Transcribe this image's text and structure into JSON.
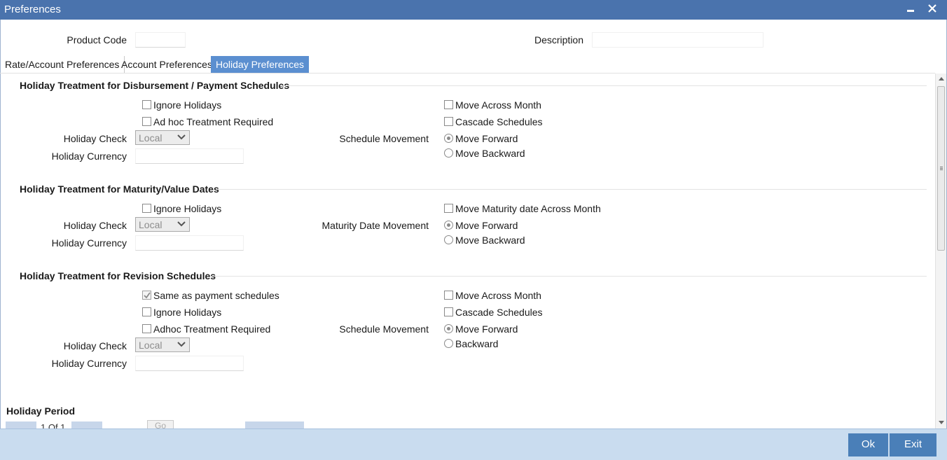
{
  "window": {
    "title": "Preferences"
  },
  "header": {
    "product_code_label": "Product Code",
    "product_code_value": "",
    "description_label": "Description",
    "description_value": ""
  },
  "tabs": [
    {
      "label": "Rate/Account Preferences",
      "active": false
    },
    {
      "label": "Account Preferences",
      "active": false
    },
    {
      "label": "Holiday Preferences",
      "active": true
    }
  ],
  "disbursement": {
    "title": "Holiday Treatment for Disbursement / Payment Schedules",
    "ignore_holidays": {
      "label": "Ignore Holidays",
      "checked": false
    },
    "adhoc_treatment": {
      "label": "Ad hoc Treatment Required",
      "checked": false
    },
    "holiday_check_label": "Holiday Check",
    "holiday_check_value": "Local",
    "holiday_currency_label": "Holiday Currency",
    "holiday_currency_value": "",
    "move_across_month": {
      "label": "Move Across Month",
      "checked": false
    },
    "cascade_schedules": {
      "label": "Cascade Schedules",
      "checked": false
    },
    "schedule_movement_label": "Schedule Movement",
    "move_forward": {
      "label": "Move Forward",
      "selected": true
    },
    "move_backward": {
      "label": "Move Backward",
      "selected": false
    }
  },
  "maturity": {
    "title": "Holiday Treatment for Maturity/Value Dates",
    "ignore_holidays": {
      "label": "Ignore Holidays",
      "checked": false
    },
    "holiday_check_label": "Holiday Check",
    "holiday_check_value": "Local",
    "holiday_currency_label": "Holiday Currency",
    "holiday_currency_value": "",
    "move_maturity_across_month": {
      "label": "Move Maturity date Across Month",
      "checked": false
    },
    "maturity_date_movement_label": "Maturity Date Movement",
    "move_forward": {
      "label": "Move Forward",
      "selected": true
    },
    "move_backward": {
      "label": "Move Backward",
      "selected": false
    }
  },
  "revision": {
    "title": "Holiday Treatment for Revision Schedules",
    "same_as_payment": {
      "label": "Same as payment schedules",
      "checked": true
    },
    "ignore_holidays": {
      "label": "Ignore Holidays",
      "checked": false
    },
    "adhoc_treatment": {
      "label": "Adhoc Treatment Required",
      "checked": false
    },
    "holiday_check_label": "Holiday Check",
    "holiday_check_value": "Local",
    "holiday_currency_label": "Holiday Currency",
    "holiday_currency_value": "",
    "move_across_month": {
      "label": "Move Across Month",
      "checked": false
    },
    "cascade_schedules": {
      "label": "Cascade Schedules",
      "checked": false
    },
    "schedule_movement_label": "Schedule Movement",
    "move_forward": {
      "label": "Move Forward",
      "selected": true
    },
    "backward": {
      "label": "Backward",
      "selected": false
    }
  },
  "holiday_period": {
    "title": "Holiday Period",
    "pager_text": "1 Of 1",
    "go_label": "Go"
  },
  "footer": {
    "ok_label": "Ok",
    "exit_label": "Exit"
  },
  "colors": {
    "titlebar": "#4a73ad",
    "active_tab": "#5b8fd0",
    "button": "#4a7fb8",
    "footer": "#c9dcef"
  }
}
